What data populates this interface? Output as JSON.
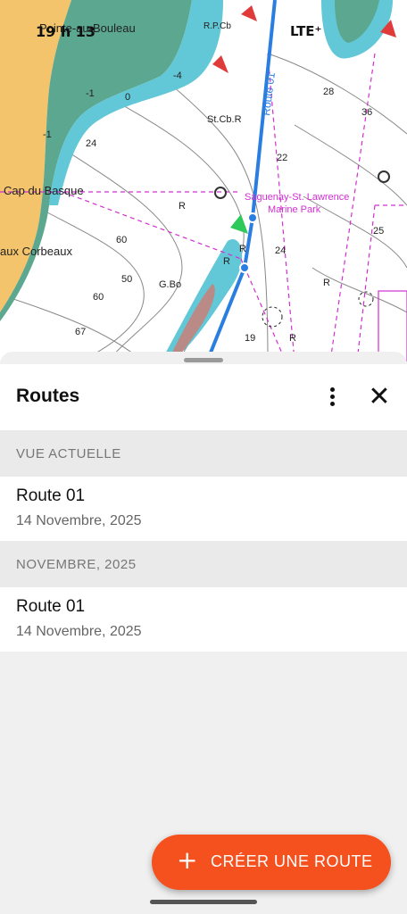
{
  "status_bar": {
    "time": "19 h 13",
    "network": "LTE⁺"
  },
  "map": {
    "place_labels": [
      "Pointe-au-Bouleau",
      "Cap du Basque",
      "aux Corbeaux",
      "Saguenay-St. Lawrence",
      "Marine Park",
      "R.P.Cb",
      "St.Cb.R",
      "G.Bo"
    ],
    "route_label": "Route 01",
    "soundings": [
      "-4",
      "-1",
      "0",
      "-1",
      "24",
      "28",
      "36",
      "22",
      "25",
      "60",
      "50",
      "60",
      "67",
      "24",
      "19",
      "R",
      "R",
      "R",
      "R",
      "R"
    ],
    "colors": {
      "land": "#f3c46b",
      "shallow_green": "#5ba78f",
      "shallow_blue": "#62c7d6",
      "water": "#ffffff",
      "route": "#2a7de1",
      "magenta": "#d22fd2"
    }
  },
  "sheet": {
    "title": "Routes",
    "menu_icon": "more-vert-icon",
    "close_icon": "close-icon",
    "sections": [
      {
        "header": "VUE ACTUELLE",
        "items": [
          {
            "name": "Route 01",
            "date": "14 Novembre, 2025"
          }
        ]
      },
      {
        "header": "NOVEMBRE, 2025",
        "items": [
          {
            "name": "Route 01",
            "date": "14 Novembre, 2025"
          }
        ]
      }
    ],
    "create_button": {
      "icon": "plus-icon",
      "label": "CRÉER UNE ROUTE"
    }
  }
}
